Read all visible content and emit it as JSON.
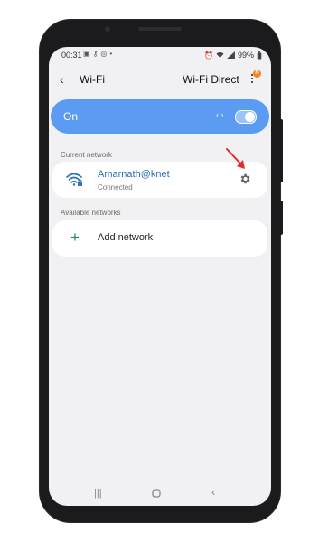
{
  "status_bar": {
    "time": "00:31",
    "left_icons": [
      "image-icon",
      "key-icon",
      "whatsapp-icon",
      "dot-icon"
    ],
    "battery": "99%"
  },
  "header": {
    "back_icon": "chevron-left-icon",
    "title": "Wi-Fi",
    "wifi_direct": "Wi-Fi Direct",
    "more_icon": "more-vertical-icon",
    "badge": "N"
  },
  "toggle_bar": {
    "label": "On",
    "state": true,
    "color": "#5b9cf2"
  },
  "current_network": {
    "section_label": "Current network",
    "name": "Amarnath@knet",
    "status": "Connected",
    "icon": "wifi-lock-icon",
    "settings_icon": "gear-icon",
    "annotation_color": "#e32b2b"
  },
  "available_networks": {
    "section_label": "Available networks",
    "add_label": "Add network",
    "add_icon": "plus-icon",
    "accent": "#1a8a5e"
  },
  "nav": {
    "recents_icon": "recents-icon",
    "home_icon": "home-icon",
    "back_icon": "back-icon"
  }
}
